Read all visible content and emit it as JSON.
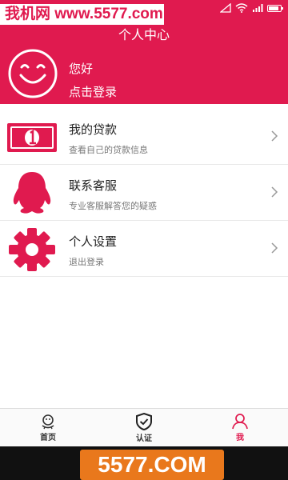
{
  "watermark": {
    "top": "我机网 www.5577.com",
    "bottom": "5577.COM"
  },
  "header": {
    "title": "个人中心",
    "greeting": "您好",
    "login": "点击登录"
  },
  "menu": [
    {
      "title": "我的贷款",
      "subtitle": "查看自己的贷款信息",
      "icon": "banknote-icon"
    },
    {
      "title": "联系客服",
      "subtitle": "专业客服解答您的疑惑",
      "icon": "qq-penguin-icon"
    },
    {
      "title": "个人设置",
      "subtitle": "退出登录",
      "icon": "gear-icon"
    }
  ],
  "tabs": [
    {
      "label": "首页",
      "icon": "home-icon",
      "active": false
    },
    {
      "label": "认证",
      "icon": "shield-check-icon",
      "active": false
    },
    {
      "label": "我",
      "icon": "user-icon",
      "active": true
    }
  ],
  "colors": {
    "brand": "#e01a4f",
    "watermark_bottom": "#e9781c",
    "nav": "#111111"
  }
}
